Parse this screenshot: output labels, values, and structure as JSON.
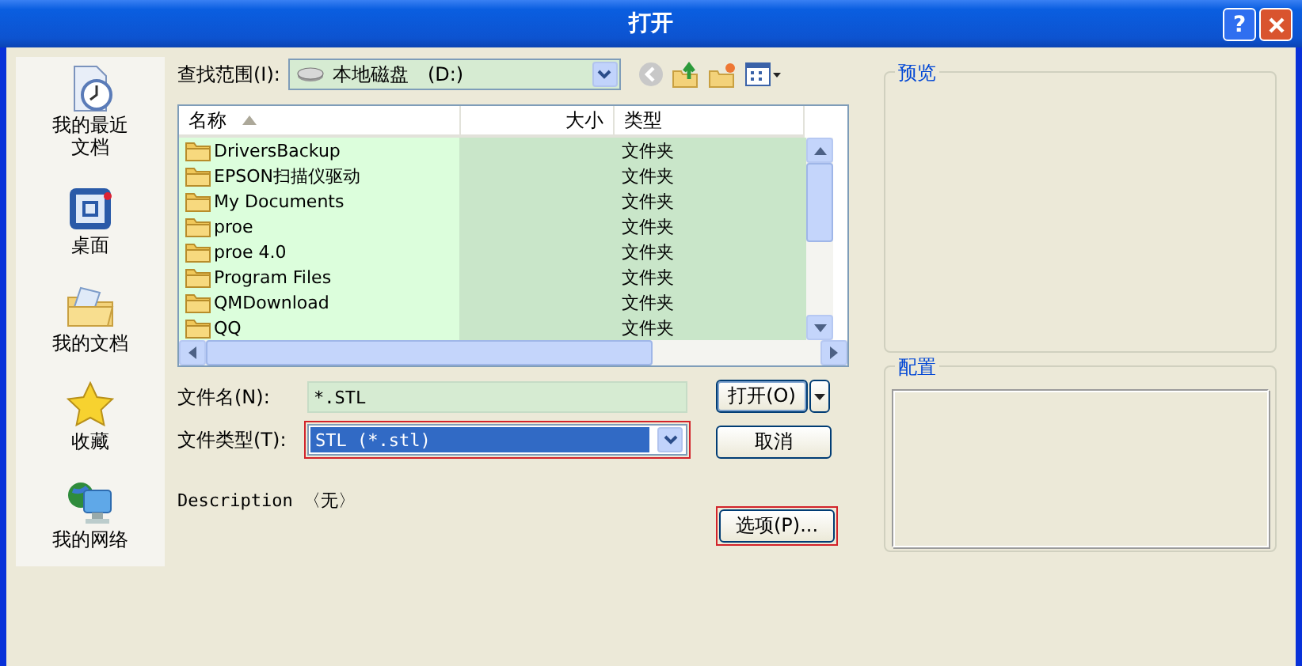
{
  "window": {
    "title": "打开",
    "help": "?"
  },
  "sidebar": {
    "items": [
      {
        "kind": "recent",
        "label": "我的最近文档"
      },
      {
        "kind": "desktop",
        "label": "桌面"
      },
      {
        "kind": "documents",
        "label": "我的文档"
      },
      {
        "kind": "favorites",
        "label": "收藏"
      },
      {
        "kind": "network",
        "label": "我的网络"
      }
    ]
  },
  "look_in": {
    "label": "查找范围(I):",
    "value": "本地磁盘　(D:)"
  },
  "file_list": {
    "columns": [
      {
        "label": "名称",
        "sorted": true
      },
      {
        "label": "大小",
        "sorted": false
      },
      {
        "label": "类型",
        "sorted": false
      }
    ],
    "rows": [
      {
        "name": "DriversBackup",
        "type": "文件夹"
      },
      {
        "name": "EPSON扫描仪驱动",
        "type": "文件夹"
      },
      {
        "name": "My Documents",
        "type": "文件夹"
      },
      {
        "name": "proe",
        "type": "文件夹"
      },
      {
        "name": "proe 4.0",
        "type": "文件夹"
      },
      {
        "name": "Program Files",
        "type": "文件夹"
      },
      {
        "name": "QMDownload",
        "type": "文件夹"
      },
      {
        "name": "QQ",
        "type": "文件夹"
      }
    ]
  },
  "file_name": {
    "label": "文件名(N):",
    "value": "*.STL"
  },
  "file_type": {
    "label": "文件类型(T):",
    "value": "STL (*.stl)",
    "highlighted": true
  },
  "description": "Description 〈无〉",
  "buttons": {
    "open": "打开(O)",
    "cancel": "取消",
    "options": {
      "label": "选项(P)...",
      "highlighted": true
    }
  },
  "panels": {
    "preview": "预览",
    "config": "配置"
  }
}
